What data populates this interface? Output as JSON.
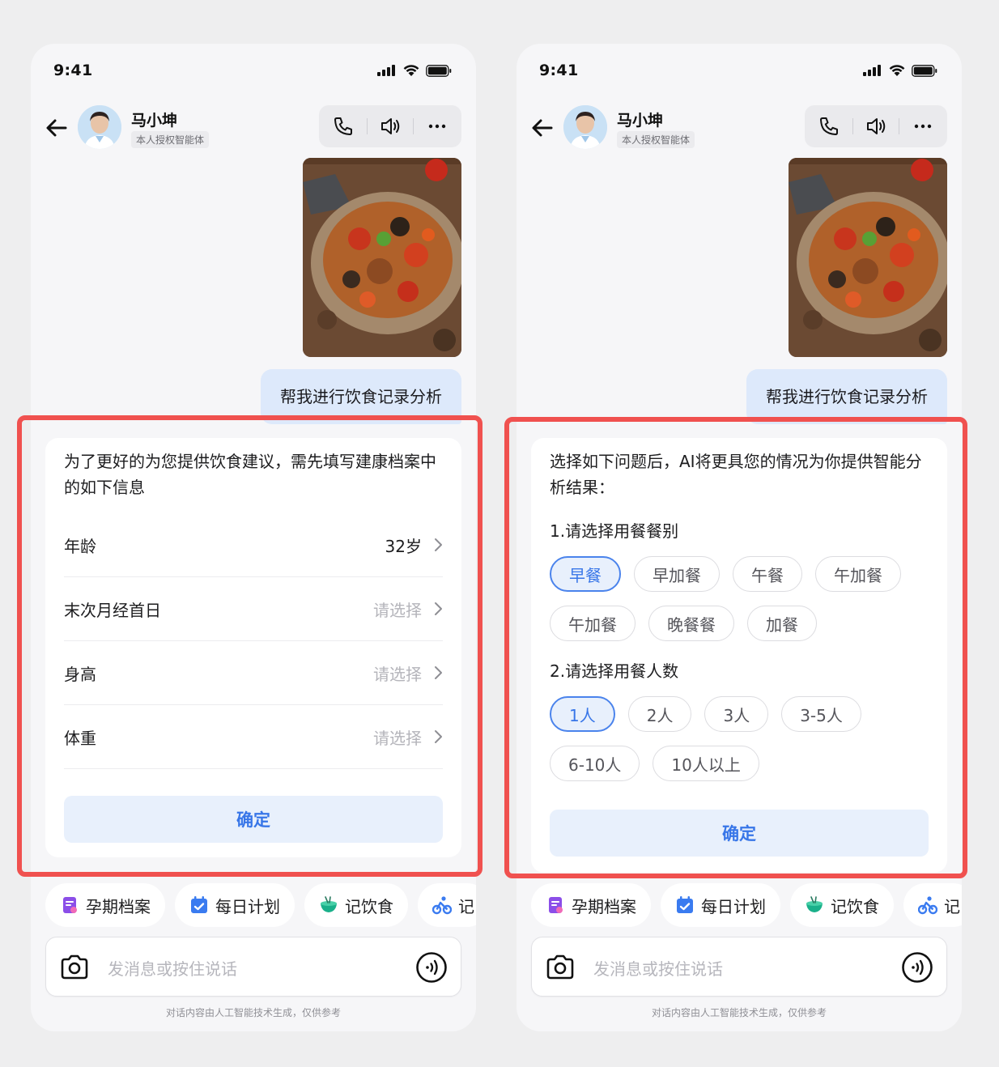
{
  "colors": {
    "accent": "#3876e8",
    "highlight": "#f0514f",
    "user_bubble": "#dde9fb",
    "selected_chip_bg": "#e8f0fc"
  },
  "screens": [
    {
      "status": {
        "time": "9:41"
      },
      "contact": {
        "name": "马小坤",
        "tag": "本人授权智能体"
      },
      "user_message": "帮我进行饮食记录分析",
      "card": {
        "intro": "为了更好的为您提供饮食建议，需先填写建康档案中的如下信息",
        "rows": [
          {
            "label": "年龄",
            "value": "32岁"
          },
          {
            "label": "末次月经首日",
            "value": "请选择"
          },
          {
            "label": "身高",
            "value": "请选择"
          },
          {
            "label": "体重",
            "value": "请选择"
          }
        ],
        "confirm": "确定"
      },
      "quick_actions": [
        {
          "label": "孕期档案",
          "icon": "pregnancy-file-icon"
        },
        {
          "label": "每日计划",
          "icon": "calendar-check-icon"
        },
        {
          "label": "记饮食",
          "icon": "food-bowl-icon"
        },
        {
          "label": "记",
          "icon": "cycling-icon"
        }
      ],
      "input_placeholder": "发消息或按住说话",
      "disclaimer": "对话内容由人工智能技术生成，仅供参考"
    },
    {
      "status": {
        "time": "9:41"
      },
      "contact": {
        "name": "马小坤",
        "tag": "本人授权智能体"
      },
      "user_message": "帮我进行饮食记录分析",
      "card": {
        "intro": "选择如下问题后，AI将更具您的情况为你提供智能分析结果：",
        "q1": {
          "title": "1.请选择用餐餐别",
          "options": [
            "早餐",
            "早加餐",
            "午餐",
            "午加餐",
            "午加餐",
            "晚餐餐",
            "加餐"
          ],
          "selected": "早餐"
        },
        "q2": {
          "title": "2.请选择用餐人数",
          "options": [
            "1人",
            "2人",
            "3人",
            "3-5人",
            "6-10人",
            "10人以上"
          ],
          "selected": "1人"
        },
        "confirm": "确定"
      },
      "quick_actions": [
        {
          "label": "孕期档案",
          "icon": "pregnancy-file-icon"
        },
        {
          "label": "每日计划",
          "icon": "calendar-check-icon"
        },
        {
          "label": "记饮食",
          "icon": "food-bowl-icon"
        },
        {
          "label": "记",
          "icon": "cycling-icon"
        }
      ],
      "input_placeholder": "发消息或按住说话",
      "disclaimer": "对话内容由人工智能技术生成，仅供参考"
    }
  ]
}
